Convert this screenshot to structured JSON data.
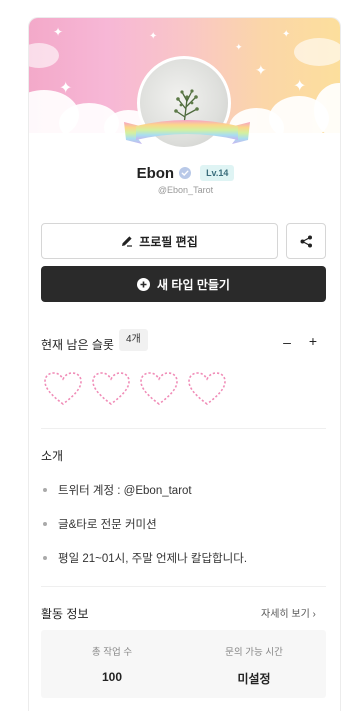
{
  "profile": {
    "name": "Ebon",
    "level": "Lv.14",
    "handle": "@Ebon_Tarot",
    "verified_icon": "verified-badge-icon"
  },
  "colors": {
    "banner_gradient": [
      "#f3a9c9",
      "#f7b7d6",
      "#f9c6c7",
      "#fbd6a8",
      "#fcdf9c"
    ],
    "heart_outline": "#f08cb7",
    "primary_button": "#2a2a2a",
    "level_badge_bg": "#dff4f4"
  },
  "actions": {
    "edit_profile_label": "프로필 편집",
    "edit_icon": "pencil-icon",
    "share_icon": "share-icon",
    "create_type_label": "새 타입 만들기",
    "create_icon": "plus-circle-icon"
  },
  "slots": {
    "label": "현재 남은 슬롯",
    "count": "4개",
    "decrement": "–",
    "increment": "+",
    "hearts_total": 4
  },
  "intro": {
    "title": "소개",
    "items": [
      "트위터 계정 : @Ebon_tarot",
      "글&타로 전문 커미션",
      "평일 21~01시, 주말 언제나 칼답합니다."
    ]
  },
  "activity": {
    "title": "활동 정보",
    "more_link": "자세히 보기 ›",
    "stats": [
      {
        "label": "총 작업 수",
        "value": "100"
      },
      {
        "label": "문의 가능 시간",
        "value": "미설정"
      }
    ]
  }
}
